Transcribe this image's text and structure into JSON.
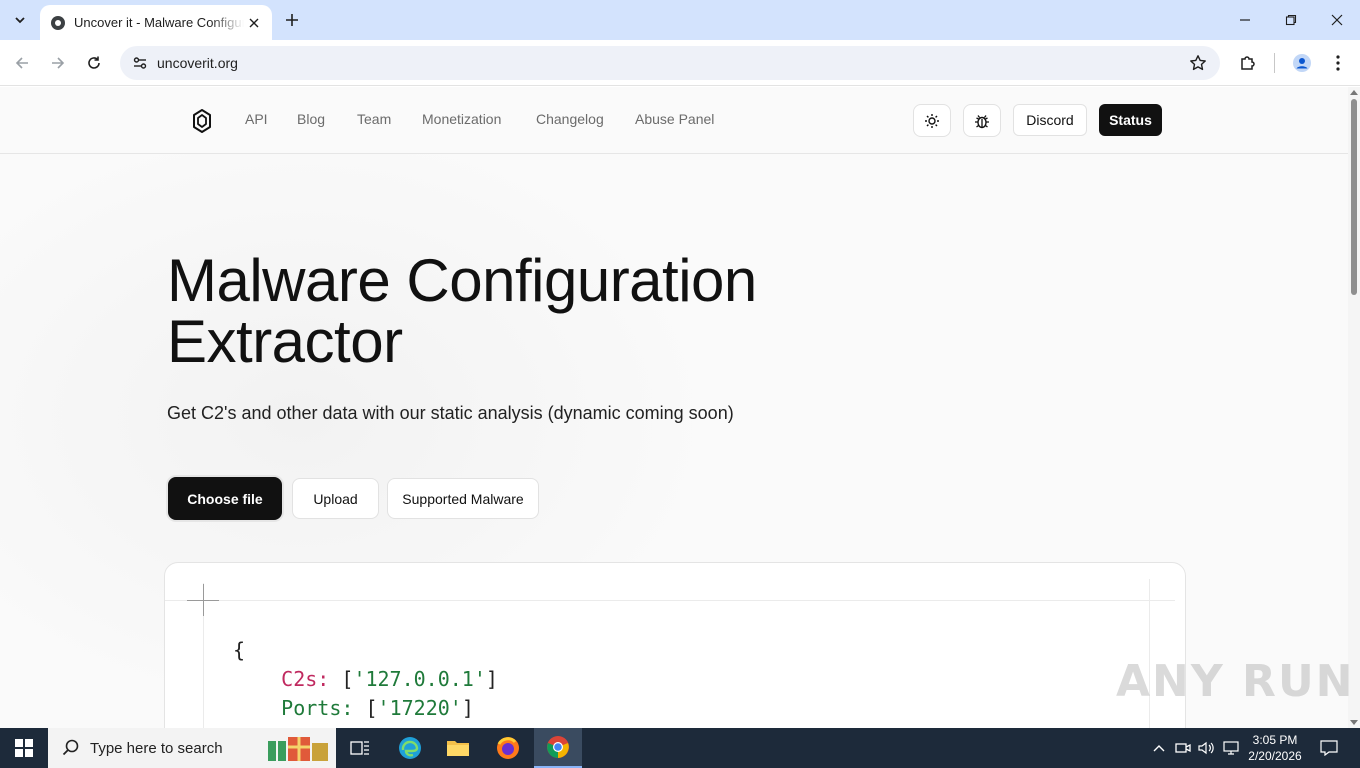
{
  "browser": {
    "tab_title": "Uncover it - Malware Configuration Extractor",
    "url": "uncoverit.org",
    "icons": {
      "tab_search": "chevron-down-icon",
      "tab_close": "close-icon",
      "new_tab": "plus-icon",
      "back": "arrow-left-icon",
      "forward": "arrow-right-icon",
      "reload": "reload-icon",
      "site_info": "tune-icon",
      "bookmark": "star-icon",
      "extensions": "puzzle-icon",
      "profile": "person-icon",
      "menu": "kebab-icon"
    }
  },
  "site": {
    "nav": {
      "links": [
        "API",
        "Blog",
        "Team",
        "Monetization",
        "Changelog",
        "Abuse Panel"
      ],
      "discord_label": "Discord",
      "status_label": "Status"
    },
    "hero": {
      "title_line1": "Malware Configuration",
      "title_line2": "Extractor",
      "subtitle": "Get C2's and other data with our static analysis (dynamic coming soon)"
    },
    "actions": {
      "choose_file": "Choose file",
      "upload": "Upload",
      "supported_malware": "Supported Malware"
    },
    "code": {
      "open_brace": "{",
      "c2s_key": "C2s",
      "c2s_value": "'127.0.0.1'",
      "ports_key": "Ports",
      "ports_value": "'17220'"
    },
    "watermark": "ANY RUN"
  },
  "taskbar": {
    "search_placeholder": "Type here to search",
    "time": "3:05 PM",
    "date": "2/20/2026"
  },
  "colors": {
    "tabbar_bg": "#d3e3fd",
    "primary_dark": "#111111",
    "code_key": "#c0295f",
    "code_string": "#1f7a3a",
    "taskbar_bg": "#1d2a3a"
  }
}
